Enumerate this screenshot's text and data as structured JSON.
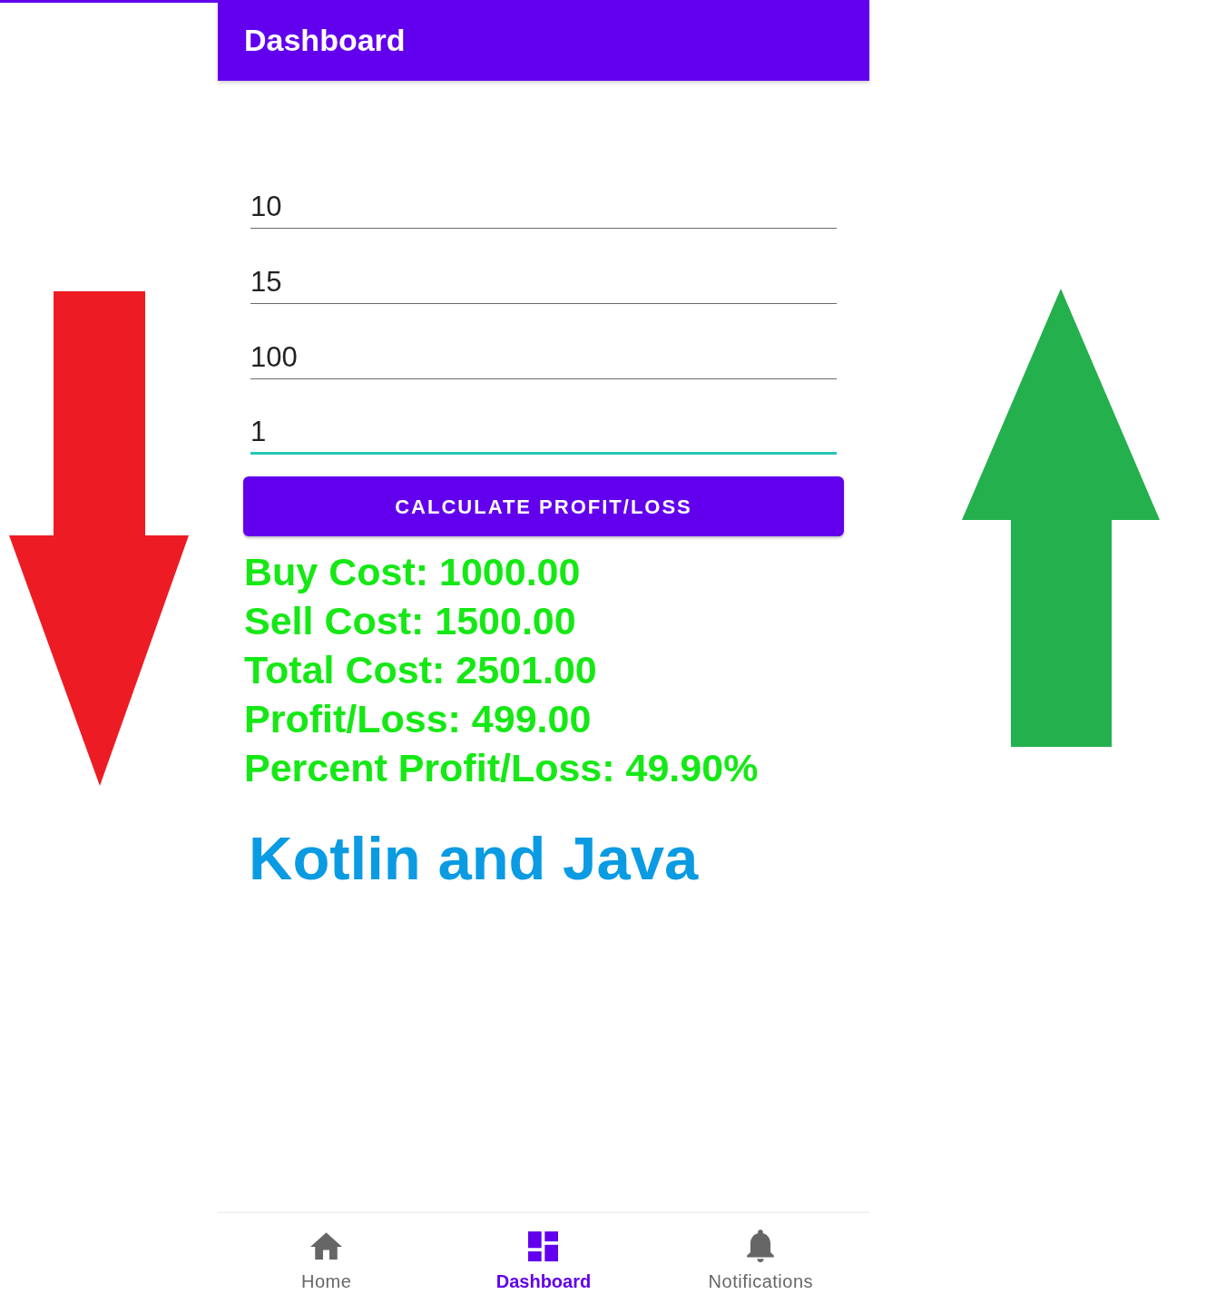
{
  "app_bar": {
    "title": "Dashboard"
  },
  "fields": [
    {
      "value": "10",
      "focused": false
    },
    {
      "value": "15",
      "focused": false
    },
    {
      "value": "100",
      "focused": false
    },
    {
      "value": "1",
      "focused": true
    }
  ],
  "button": {
    "label": "CALCULATE PROFIT/LOSS"
  },
  "results": [
    "Buy Cost: 1000.00",
    "Sell Cost: 1500.00",
    "Total Cost: 2501.00",
    "Profit/Loss: 499.00",
    "Percent Profit/Loss: 49.90%"
  ],
  "caption": "Kotlin and Java",
  "bottom_nav": [
    {
      "label": "Home",
      "selected": false
    },
    {
      "label": "Dashboard",
      "selected": true
    },
    {
      "label": "Notifications",
      "selected": false
    }
  ]
}
